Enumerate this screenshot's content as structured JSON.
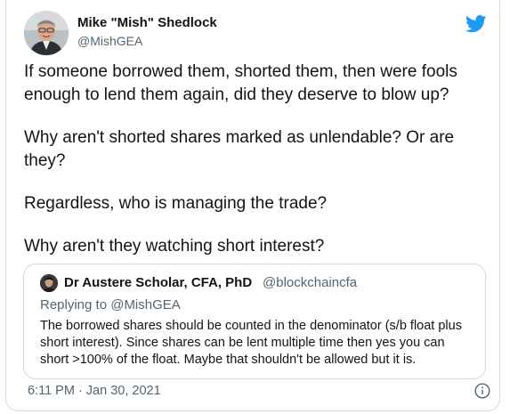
{
  "author": {
    "name": "Mike \"Mish\" Shedlock",
    "handle": "@MishGEA"
  },
  "tweet": {
    "paragraphs": [
      "If someone borrowed them, shorted them, then were fools\nenough to lend them again, did they deserve to blow up?",
      "Why aren't shorted shares marked as unlendable? Or are\nthey?",
      "Regardless, who is managing the trade?",
      "Why aren't they watching short interest?"
    ],
    "timestamp": "6:11 PM · Jan 30, 2021"
  },
  "quoted_tweet": {
    "author_name": "Dr Austere Scholar, CFA, PhD",
    "author_handle": "@blockchaincfa",
    "replying_to": "Replying to @MishGEA",
    "text": "The borrowed shares should be counted in the denominator (s/b float plus short interest). Since shares can be lent multiple time then yes you can short >100% of the float. Maybe that shouldn't be allowed but it is."
  },
  "icons": {
    "brand": "twitter-bird-icon",
    "info": "info-icon"
  },
  "colors": {
    "twitter_blue": "#1d9bf0",
    "secondary_text": "#536471",
    "border": "#cfd9de"
  }
}
